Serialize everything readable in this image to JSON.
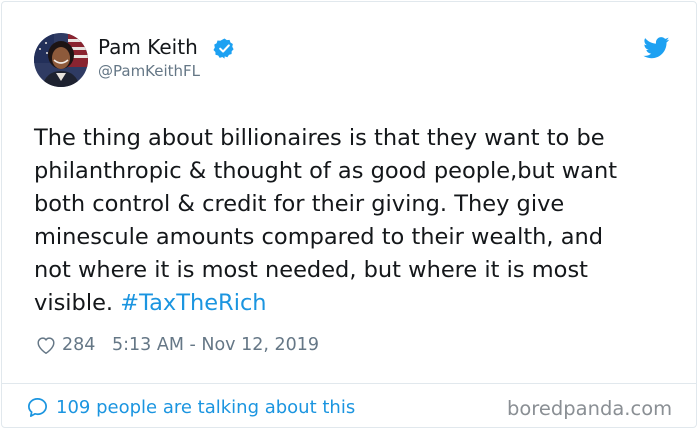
{
  "author": {
    "display_name": "Pam Keith",
    "handle": "@PamKeithFL",
    "verified": true
  },
  "tweet": {
    "lines": [
      "The thing about billionaires is that they want to be",
      "philanthropic & thought of as good people,but want",
      "both control & credit for their giving. They give",
      "minescule amounts compared to their wealth, and",
      "not where it is most needed, but where it is most",
      "visible."
    ],
    "hashtag": "#TaxTheRich"
  },
  "meta": {
    "likes": "284",
    "timestamp": "5:13 AM - Nov 12, 2019"
  },
  "footer": {
    "talking": "109 people are talking about this",
    "watermark": "boredpanda.com"
  },
  "icons": {
    "like": "heart-icon",
    "reply": "speech-bubble-icon",
    "brand": "twitter-bird-icon",
    "badge": "verified-badge-icon"
  },
  "colors": {
    "text": "#14171a",
    "secondary": "#657786",
    "link": "#1b95e0",
    "border": "#e1e8ed"
  }
}
